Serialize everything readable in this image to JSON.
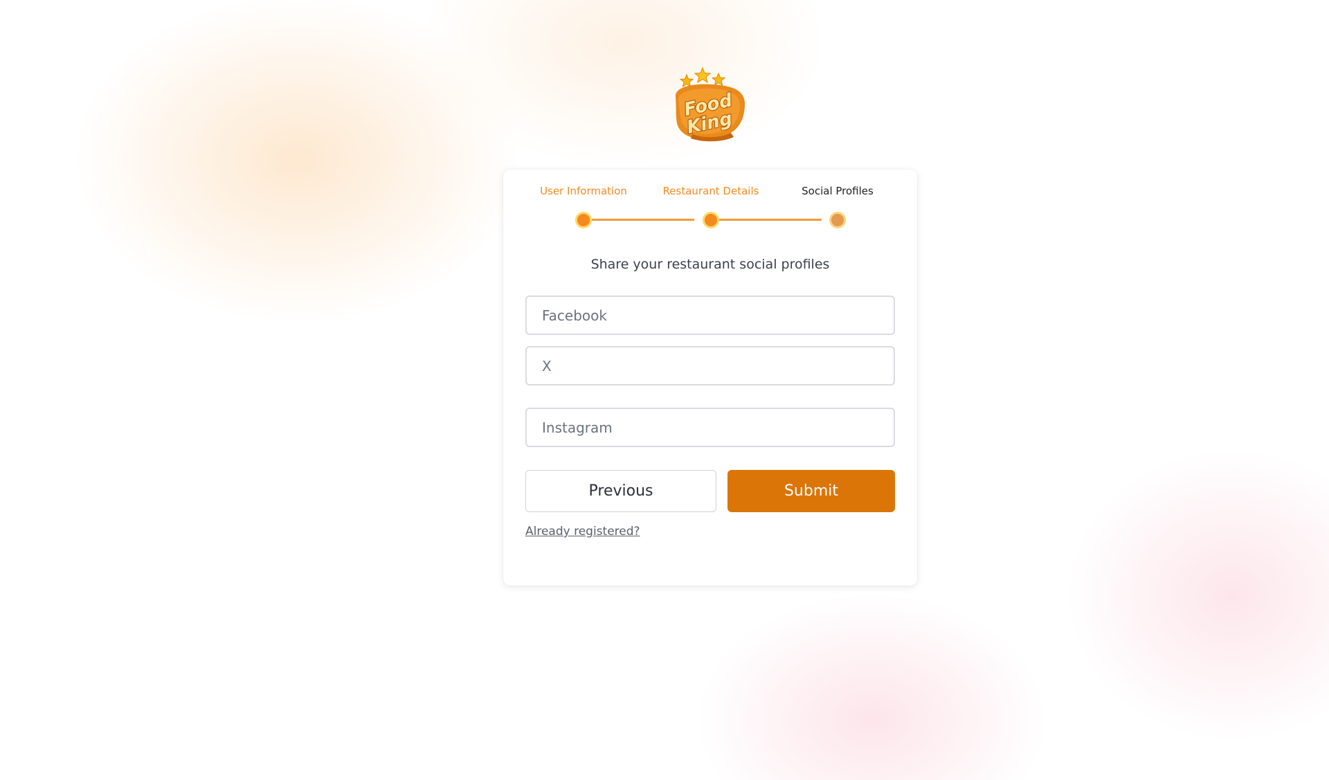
{
  "brand": {
    "logo_name": "foodking-logo",
    "logo_line1": "Food",
    "logo_line2": "King"
  },
  "stepper": {
    "steps": [
      {
        "label": "User Information",
        "state": "done"
      },
      {
        "label": "Restaurant Details",
        "state": "done"
      },
      {
        "label": "Social Profiles",
        "state": "current"
      }
    ],
    "active_color": "#f38a1f"
  },
  "form": {
    "subtitle": "Share your restaurant social profiles",
    "facebook_placeholder": "Facebook",
    "x_placeholder": "X",
    "instagram_placeholder": "Instagram",
    "facebook_value": "",
    "x_value": "",
    "instagram_value": ""
  },
  "actions": {
    "previous_label": "Previous",
    "submit_label": "Submit",
    "submit_color": "#db7507",
    "login_link": "Already registered?"
  }
}
